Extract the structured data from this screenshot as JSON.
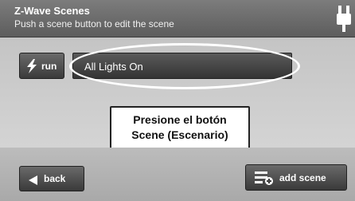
{
  "header": {
    "title": "Z-Wave Scenes",
    "subtitle": "Push a scene button to edit the scene",
    "status_icon": "plug-icon"
  },
  "scene": {
    "run_label": "run",
    "run_icon": "lightning-bolt-icon",
    "name": "All Lights On"
  },
  "callout": {
    "line1": "Presione el botón",
    "line2": "Scene (Escenario)"
  },
  "footer": {
    "back_label": "back",
    "back_icon": "left-arrow-icon",
    "add_label": "add scene",
    "add_icon": "add-scene-icon"
  },
  "colors": {
    "header_bg": "#6a6a6a",
    "content_bg": "#c9c9c9",
    "button_bg": "#3a3a3a",
    "button_text": "#ffffff"
  }
}
